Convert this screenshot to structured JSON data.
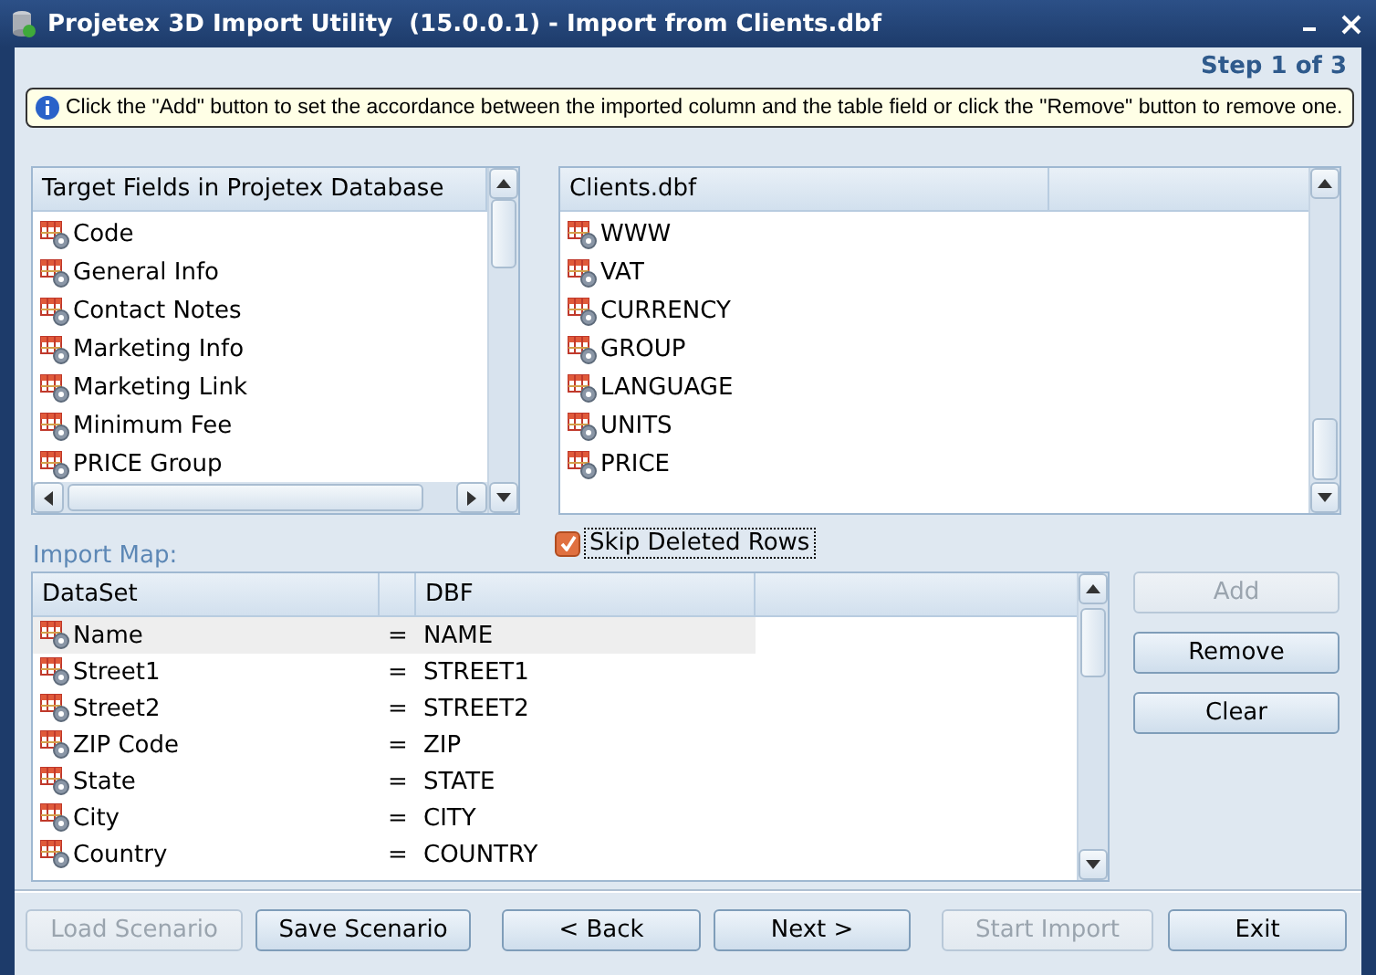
{
  "window": {
    "title": "Projetex 3D Import Utility  (15.0.0.1) - Import from Clients.dbf",
    "step": "Step 1 of 3"
  },
  "hint": "Click the \"Add\" button to set the accordance between the imported column and the table field or click the \"Remove\" button to remove one.",
  "target_list": {
    "header": "Target Fields in Projetex Database",
    "items": [
      "Code",
      "General Info",
      "Contact Notes",
      "Marketing Info",
      "Marketing Link",
      "Minimum Fee",
      "PRICE Group"
    ]
  },
  "source_list": {
    "header": "Clients.dbf",
    "items": [
      "WWW",
      "VAT",
      "CURRENCY",
      "GROUP",
      "LANGUAGE",
      "UNITS",
      "PRICE"
    ]
  },
  "skip_deleted_rows": {
    "label": "Skip Deleted Rows",
    "checked": true
  },
  "import_map": {
    "label": "Import Map:",
    "columns": [
      "DataSet",
      "DBF"
    ],
    "rows": [
      {
        "dataset": "Name",
        "sign": "=",
        "dbf": "NAME",
        "selected": true
      },
      {
        "dataset": "Street1",
        "sign": "=",
        "dbf": "STREET1",
        "selected": false
      },
      {
        "dataset": "Street2",
        "sign": "=",
        "dbf": "STREET2",
        "selected": false
      },
      {
        "dataset": "ZIP Code",
        "sign": "=",
        "dbf": "ZIP",
        "selected": false
      },
      {
        "dataset": "State",
        "sign": "=",
        "dbf": "STATE",
        "selected": false
      },
      {
        "dataset": "City",
        "sign": "=",
        "dbf": "CITY",
        "selected": false
      },
      {
        "dataset": "Country",
        "sign": "=",
        "dbf": "COUNTRY",
        "selected": false
      }
    ]
  },
  "side_buttons": [
    {
      "label": "Add",
      "disabled": true
    },
    {
      "label": "Remove",
      "disabled": false
    },
    {
      "label": "Clear",
      "disabled": false
    }
  ],
  "footer_buttons": [
    {
      "label": "Load Scenario",
      "disabled": true
    },
    {
      "label": "Save Scenario",
      "disabled": false
    },
    {
      "label": "< Back",
      "disabled": false
    },
    {
      "label": "Next >",
      "disabled": false
    },
    {
      "label": "Start Import",
      "disabled": true
    },
    {
      "label": "Exit",
      "disabled": false
    }
  ]
}
